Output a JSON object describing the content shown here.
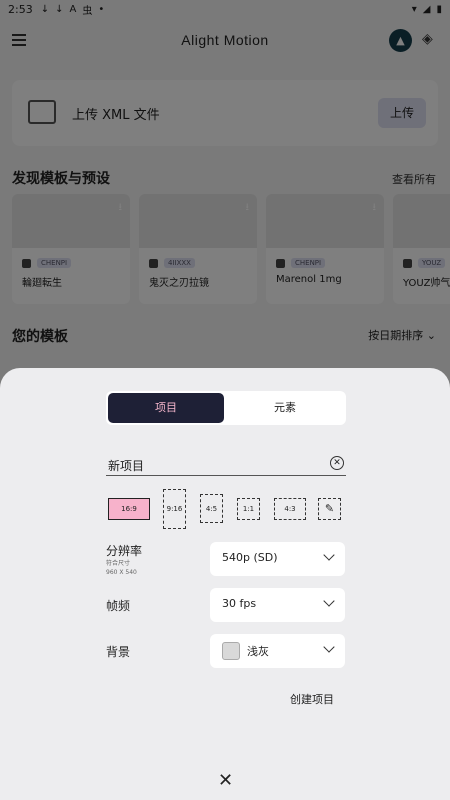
{
  "status": {
    "time": "2:53",
    "icons": [
      "↓",
      "↓",
      "A",
      "虫",
      "•"
    ]
  },
  "header": {
    "title": "Alight Motion"
  },
  "upload": {
    "text": "上传 XML 文件",
    "button": "上传"
  },
  "discover": {
    "title": "发现模板与预设",
    "see_all": "查看所有",
    "templates": [
      {
        "author": "CHENPI",
        "name": "輪廻転生"
      },
      {
        "author": "4IIXXX",
        "name": "鬼灭之刃拉镜"
      },
      {
        "author": "CHENPI",
        "name": "Marenol 1mg"
      },
      {
        "author": "YOUZ",
        "name": "YOUZ帅气"
      }
    ]
  },
  "my_templates": {
    "title": "您的模板",
    "sort": "按日期排序"
  },
  "sheet": {
    "tabs": {
      "project": "项目",
      "element": "元素"
    },
    "project_name": "新项目",
    "ratios": [
      "16:9",
      "9:16",
      "4:5",
      "1:1",
      "4:3"
    ],
    "resolution": {
      "label": "分辨率",
      "sub1": "符合尺寸",
      "sub2": "960 X 540",
      "value": "540p (SD)"
    },
    "framerate": {
      "label": "帧频",
      "value": "30 fps"
    },
    "background": {
      "label": "背景",
      "value": "浅灰"
    },
    "create": "创建项目",
    "close": "✕"
  },
  "colors": {
    "accent_dark": "#1e2036",
    "accent_pink": "#f7b2cb",
    "sheet_bg": "#ededef"
  }
}
